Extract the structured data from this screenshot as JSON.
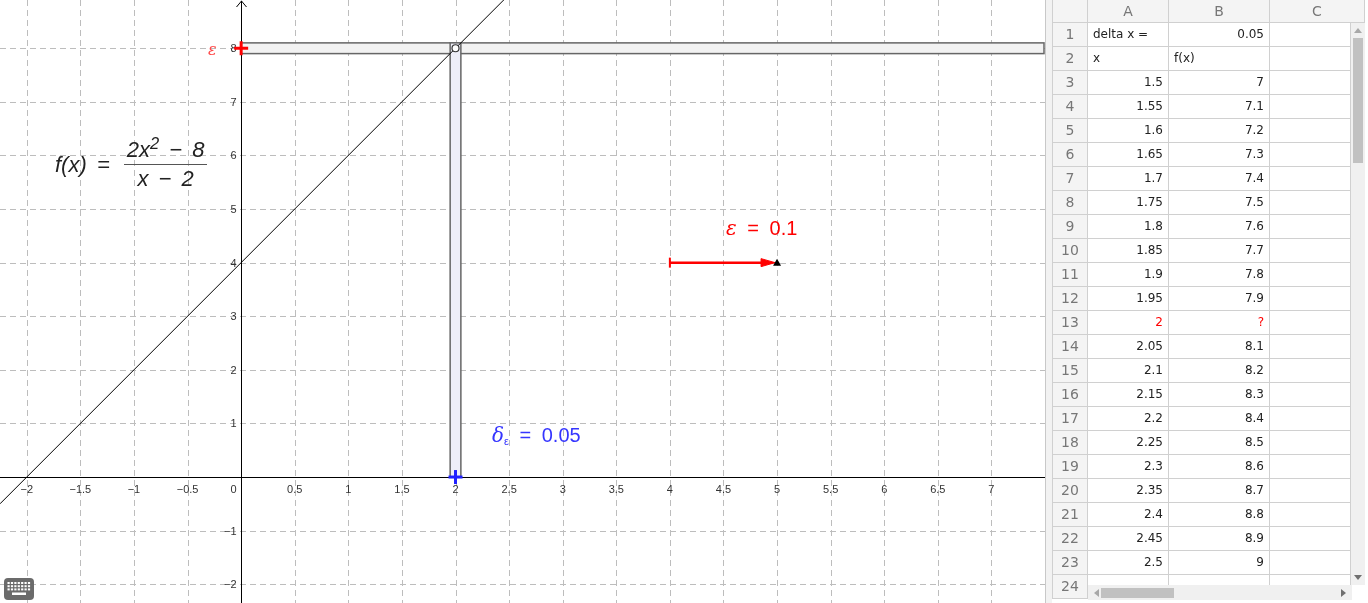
{
  "graphics_view": {
    "function_formula": {
      "lhs": "f(x) =",
      "numerator": "2x$^{2}$ − 8",
      "denominator": "x − 2"
    },
    "point_label": "ε",
    "epsilon_label": "*ε* = 0.1",
    "delta_label": "*δ*$_{ε}$ = 0.05",
    "markers": [
      {
        "kind": "hole"
      },
      {
        "kind": "ymark",
        "color": "#ff0000"
      },
      {
        "kind": "xmark",
        "color": "#2020ff"
      }
    ],
    "epsilon_slider": {
      "level": 1
    },
    "chart_data": {
      "type": "line",
      "grid": true,
      "xlim": [
        -2.25,
        7.5
      ],
      "ylim": [
        -2.35,
        8.9
      ],
      "xticks": [
        {
          "value": -2,
          "label": "−2"
        },
        {
          "value": -1.5,
          "label": "−1.5"
        },
        {
          "value": -1,
          "label": "−1"
        },
        {
          "value": -0.5,
          "label": "−0.5"
        },
        0,
        0.5,
        1,
        1.5,
        2,
        2.5,
        3,
        3.5,
        4,
        4.5,
        5,
        5.5,
        6,
        6.5,
        7
      ],
      "yticks": [
        {
          "value": -2,
          "label": "−2"
        },
        {
          "value": -1,
          "label": "−1"
        },
        1,
        2,
        3,
        4,
        5,
        6,
        7,
        8
      ],
      "x": [
        -2.25,
        2.45
      ],
      "series": [
        {
          "color": "#000000",
          "values": [
            -0.5,
            8.9
          ]
        }
      ],
      "bands": [
        {
          "axis": "y",
          "from": 7.9,
          "to": 8.1,
          "color": "#f2f2f2"
        },
        {
          "axis": "x",
          "from": 1.95,
          "to": 2.05,
          "color": "#eeeef8"
        }
      ]
    }
  },
  "spreadsheet": {
    "columns": [
      "A",
      "B",
      "C"
    ],
    "rows": [
      {
        "number": "1",
        "cells": [
          {
            "text": "delta x =",
            "kind": "text",
            "highlighted": false
          },
          {
            "text": "0.05",
            "kind": "number",
            "highlighted": false
          }
        ]
      },
      {
        "number": "2",
        "cells": [
          {
            "text": "x",
            "kind": "text",
            "highlighted": false
          },
          {
            "text": "f(x)",
            "kind": "text",
            "highlighted": false
          }
        ]
      },
      {
        "number": "3",
        "cells": [
          {
            "text": "1.5",
            "kind": "number",
            "highlighted": false
          },
          {
            "text": "7",
            "kind": "number",
            "highlighted": false
          }
        ]
      },
      {
        "number": "4",
        "cells": [
          {
            "text": "1.55",
            "kind": "number",
            "highlighted": false
          },
          {
            "text": "7.1",
            "kind": "number",
            "highlighted": false
          }
        ]
      },
      {
        "number": "5",
        "cells": [
          {
            "text": "1.6",
            "kind": "number",
            "highlighted": false
          },
          {
            "text": "7.2",
            "kind": "number",
            "highlighted": false
          }
        ]
      },
      {
        "number": "6",
        "cells": [
          {
            "text": "1.65",
            "kind": "number",
            "highlighted": false
          },
          {
            "text": "7.3",
            "kind": "number",
            "highlighted": false
          }
        ]
      },
      {
        "number": "7",
        "cells": [
          {
            "text": "1.7",
            "kind": "number",
            "highlighted": false
          },
          {
            "text": "7.4",
            "kind": "number",
            "highlighted": false
          }
        ]
      },
      {
        "number": "8",
        "cells": [
          {
            "text": "1.75",
            "kind": "number",
            "highlighted": false
          },
          {
            "text": "7.5",
            "kind": "number",
            "highlighted": false
          }
        ]
      },
      {
        "number": "9",
        "cells": [
          {
            "text": "1.8",
            "kind": "number",
            "highlighted": false
          },
          {
            "text": "7.6",
            "kind": "number",
            "highlighted": false
          }
        ]
      },
      {
        "number": "10",
        "cells": [
          {
            "text": "1.85",
            "kind": "number",
            "highlighted": false
          },
          {
            "text": "7.7",
            "kind": "number",
            "highlighted": false
          }
        ]
      },
      {
        "number": "11",
        "cells": [
          {
            "text": "1.9",
            "kind": "number",
            "highlighted": false
          },
          {
            "text": "7.8",
            "kind": "number",
            "highlighted": false
          }
        ]
      },
      {
        "number": "12",
        "cells": [
          {
            "text": "1.95",
            "kind": "number",
            "highlighted": false
          },
          {
            "text": "7.9",
            "kind": "number",
            "highlighted": false
          }
        ]
      },
      {
        "number": "13",
        "cells": [
          {
            "text": "2",
            "kind": "number",
            "highlighted": true
          },
          {
            "text": "?",
            "kind": "number",
            "highlighted": true
          }
        ]
      },
      {
        "number": "14",
        "cells": [
          {
            "text": "2.05",
            "kind": "number",
            "highlighted": false
          },
          {
            "text": "8.1",
            "kind": "number",
            "highlighted": false
          }
        ]
      },
      {
        "number": "15",
        "cells": [
          {
            "text": "2.1",
            "kind": "number",
            "highlighted": false
          },
          {
            "text": "8.2",
            "kind": "number",
            "highlighted": false
          }
        ]
      },
      {
        "number": "16",
        "cells": [
          {
            "text": "2.15",
            "kind": "number",
            "highlighted": false
          },
          {
            "text": "8.3",
            "kind": "number",
            "highlighted": false
          }
        ]
      },
      {
        "number": "17",
        "cells": [
          {
            "text": "2.2",
            "kind": "number",
            "highlighted": false
          },
          {
            "text": "8.4",
            "kind": "number",
            "highlighted": false
          }
        ]
      },
      {
        "number": "18",
        "cells": [
          {
            "text": "2.25",
            "kind": "number",
            "highlighted": false
          },
          {
            "text": "8.5",
            "kind": "number",
            "highlighted": false
          }
        ]
      },
      {
        "number": "19",
        "cells": [
          {
            "text": "2.3",
            "kind": "number",
            "highlighted": false
          },
          {
            "text": "8.6",
            "kind": "number",
            "highlighted": false
          }
        ]
      },
      {
        "number": "20",
        "cells": [
          {
            "text": "2.35",
            "kind": "number",
            "highlighted": false
          },
          {
            "text": "8.7",
            "kind": "number",
            "highlighted": false
          }
        ]
      },
      {
        "number": "21",
        "cells": [
          {
            "text": "2.4",
            "kind": "number",
            "highlighted": false
          },
          {
            "text": "8.8",
            "kind": "number",
            "highlighted": false
          }
        ]
      },
      {
        "number": "22",
        "cells": [
          {
            "text": "2.45",
            "kind": "number",
            "highlighted": false
          },
          {
            "text": "8.9",
            "kind": "number",
            "highlighted": false
          }
        ]
      },
      {
        "number": "23",
        "cells": [
          {
            "text": "2.5",
            "kind": "number",
            "highlighted": false
          },
          {
            "text": "9",
            "kind": "number",
            "highlighted": false
          }
        ]
      },
      {
        "number": "24"
      }
    ]
  }
}
